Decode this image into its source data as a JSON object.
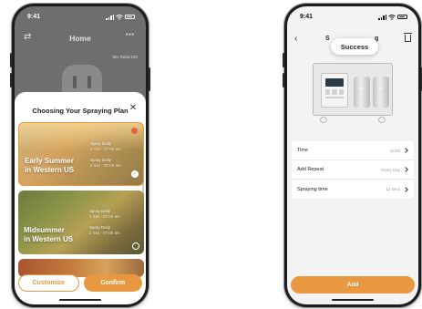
{
  "colors": {
    "accent": "#e89841",
    "dot": "#e2663b"
  },
  "left_phone": {
    "status": {
      "time": "9:41"
    },
    "header": {
      "title": "Home",
      "more_icon": "⋯",
      "swap_icon": "⇄"
    },
    "mix_ratio": "Mix Ratio:100",
    "sheet": {
      "title": "Choosing Your Spraying Plan",
      "close": "✕",
      "plans": [
        {
          "name_line1": "Early Summer",
          "name_line2": "in Western US",
          "spray1_title": "Spray Daily",
          "spray1_detail": "2 min · 07:00 am",
          "spray2_title": "Spray Daily",
          "spray2_detail": "2 min · 07:00 am",
          "selected": true
        },
        {
          "name_line1": "Midsummer",
          "name_line2": "in Western US",
          "spray1_title": "Spray Daily",
          "spray1_detail": "2 min · 07:00 am",
          "spray2_title": "Spray Daily",
          "spray2_detail": "2 min · 07:00 am",
          "selected": false
        }
      ],
      "customize_label": "Customize",
      "confirm_label": "Confirm"
    }
  },
  "right_phone": {
    "status": {
      "time": "9:41"
    },
    "header": {
      "back": "‹",
      "title_left": "S",
      "title_right": "g"
    },
    "toast": "Success",
    "device": {
      "can1": "B1",
      "can2": "B2"
    },
    "settings": [
      {
        "label": "Time",
        "value": "12:00"
      },
      {
        "label": "Add Repeat",
        "value": "Every Day"
      },
      {
        "label": "Spraying time",
        "value": "12 secs"
      }
    ],
    "add_label": "Add"
  }
}
